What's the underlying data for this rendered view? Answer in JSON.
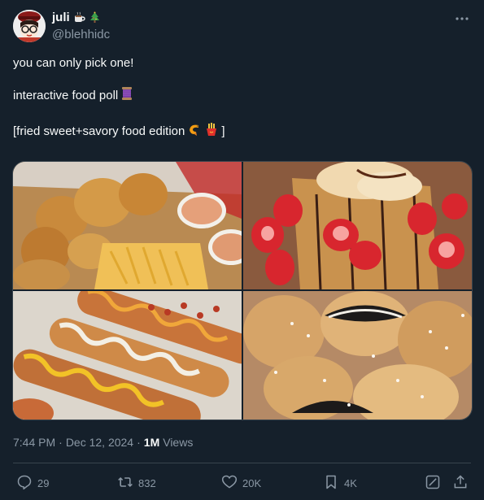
{
  "author": {
    "display_name": "juli",
    "handle": "@blehhidc",
    "name_icons": [
      "coffee-icon",
      "christmas-tree-icon"
    ]
  },
  "tweet": {
    "line1": "you can only pick one!",
    "line2": "interactive food poll",
    "line3_prefix": "[fried sweet+savory food edition",
    "line3_suffix": "]",
    "line2_icon": "thread-spool-icon",
    "line3_icons": [
      "shrimp-icon",
      "fries-icon"
    ]
  },
  "media": {
    "images": [
      "fried chicken tenders with crinkle fries and dipping sauce",
      "waffle with strawberries, ice cream and chocolate drizzle",
      "corn dogs with mustard and ketchup",
      "fried oreos with powdered sugar"
    ]
  },
  "meta": {
    "time": "7:44 PM",
    "separator": "·",
    "date": "Dec 12, 2024",
    "views_count": "1M",
    "views_label": "Views"
  },
  "actions": {
    "replies": "29",
    "retweets": "832",
    "likes": "20K",
    "bookmarks": "4K"
  },
  "colors": {
    "background": "#15202b",
    "text": "#f7f9f9",
    "muted": "#8b98a5",
    "border": "#38444d"
  }
}
